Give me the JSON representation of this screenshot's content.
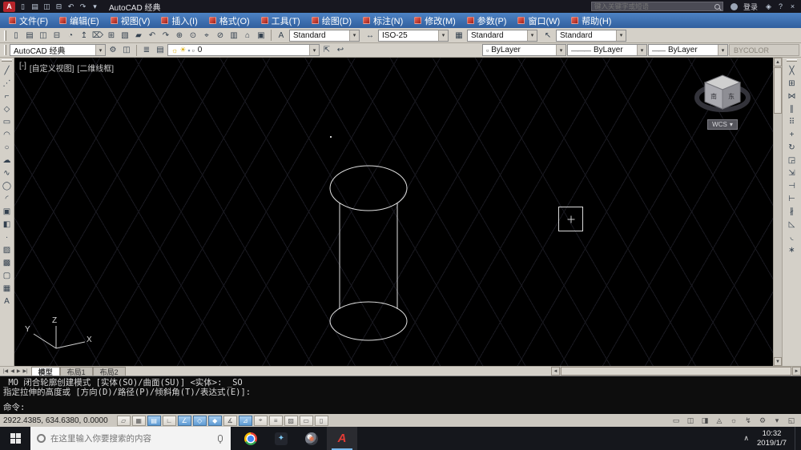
{
  "glyphs": {
    "chevron_down": "▾",
    "scroll_up": "▲",
    "scroll_down": "▼",
    "scroll_left": "◄",
    "scroll_right": "►"
  },
  "title_bar": {
    "app_logo": "A",
    "quick_access": [
      {
        "name": "qa-new-icon",
        "glyph": "▯"
      },
      {
        "name": "qa-open-icon",
        "glyph": "▤"
      },
      {
        "name": "qa-save-icon",
        "glyph": "◫"
      },
      {
        "name": "qa-plot-icon",
        "glyph": "⊟"
      },
      {
        "name": "qa-undo-icon",
        "glyph": "↶"
      },
      {
        "name": "qa-redo-icon",
        "glyph": "↷"
      },
      {
        "name": "qa-dropdown-icon",
        "glyph": "▾"
      }
    ],
    "title": "AutoCAD 经典",
    "search_placeholder": "键入关键字或短语",
    "signin_label": "登录",
    "right_icons": [
      {
        "name": "exchange-apps-icon",
        "glyph": "◈"
      },
      {
        "name": "help-icon",
        "glyph": "?"
      },
      {
        "name": "close-icon",
        "glyph": "×"
      }
    ]
  },
  "menu_bar": {
    "items": [
      {
        "label": "文件(F)"
      },
      {
        "label": "编辑(E)"
      },
      {
        "label": "视图(V)"
      },
      {
        "label": "插入(I)"
      },
      {
        "label": "格式(O)"
      },
      {
        "label": "工具(T)"
      },
      {
        "label": "绘图(D)"
      },
      {
        "label": "标注(N)"
      },
      {
        "label": "修改(M)"
      },
      {
        "label": "参数(P)"
      },
      {
        "label": "窗口(W)"
      },
      {
        "label": "帮助(H)"
      }
    ]
  },
  "standard_toolbar": {
    "icons": [
      {
        "name": "new-icon",
        "glyph": "▯"
      },
      {
        "name": "open-icon",
        "glyph": "▤"
      },
      {
        "name": "save-icon",
        "glyph": "◫"
      },
      {
        "name": "print-icon",
        "glyph": "⊟"
      },
      {
        "name": "plot-preview-icon",
        "glyph": "◔"
      },
      {
        "name": "publish-icon",
        "glyph": "↥"
      },
      {
        "name": "cut-icon",
        "glyph": "⌦"
      },
      {
        "name": "copy-clip-icon",
        "glyph": "⊞"
      },
      {
        "name": "paste-icon",
        "glyph": "▧"
      },
      {
        "name": "match-properties-icon",
        "glyph": "▰"
      },
      {
        "name": "undo-icon",
        "glyph": "↶"
      },
      {
        "name": "redo-icon",
        "glyph": "↷"
      },
      {
        "name": "pan-icon",
        "glyph": "⊕"
      },
      {
        "name": "zoom-realtime-icon",
        "glyph": "⊙"
      },
      {
        "name": "zoom-window-icon",
        "glyph": "⌖"
      },
      {
        "name": "zoom-previous-icon",
        "glyph": "⊘"
      },
      {
        "name": "properties-icon",
        "glyph": "▥"
      },
      {
        "name": "designcenter-icon",
        "glyph": "⌂"
      },
      {
        "name": "tool-palettes-icon",
        "glyph": "▣"
      }
    ]
  },
  "styles_toolbar": {
    "combos": [
      {
        "name": "text-style-combo",
        "icon_name": "text-style-icon",
        "icon": "A",
        "value": "Standard"
      },
      {
        "name": "dim-style-combo",
        "icon_name": "dim-style-icon",
        "icon": "↔",
        "value": "ISO-25"
      },
      {
        "name": "table-style-combo",
        "icon_name": "table-style-icon",
        "icon": "▦",
        "value": "Standard"
      },
      {
        "name": "mleader-style-combo",
        "icon_name": "mleader-style-icon",
        "icon": "↖",
        "value": "Standard"
      }
    ]
  },
  "workspace_toolbar": {
    "value": "AutoCAD 经典",
    "gear_glyph": "⚙",
    "save_glyph": "◫"
  },
  "layers_toolbar": {
    "buttons": [
      {
        "name": "layer-properties-icon",
        "glyph": "≣"
      },
      {
        "name": "layer-states-icon",
        "glyph": "▤"
      }
    ],
    "combo": {
      "toggles": [
        {
          "name": "layer-on-icon",
          "glyph": "☼",
          "color": "#d8a800"
        },
        {
          "name": "layer-freeze-icon",
          "glyph": "☀",
          "color": "#d8a800"
        },
        {
          "name": "layer-lock-icon",
          "glyph": "▪",
          "color": "#7d93a8"
        },
        {
          "name": "layer-color-chip",
          "glyph": "▫",
          "color": "#555555"
        }
      ],
      "value": "0"
    },
    "extra_buttons": [
      {
        "name": "make-current-icon",
        "glyph": "⇱"
      },
      {
        "name": "layer-previous-icon",
        "glyph": "↩"
      }
    ]
  },
  "properties_toolbar": {
    "color": {
      "value": "ByLayer"
    },
    "linetype": {
      "sample": "———",
      "value": "ByLayer"
    },
    "lineweight": {
      "sample": "——",
      "value": "ByLayer"
    },
    "plot_style": {
      "value": "BYCOLOR"
    }
  },
  "draw_toolbar": {
    "icons": [
      {
        "name": "line-icon",
        "glyph": "╱"
      },
      {
        "name": "construction-line-icon",
        "glyph": "⋰"
      },
      {
        "name": "polyline-icon",
        "glyph": "⌐"
      },
      {
        "name": "polygon-icon",
        "glyph": "◇"
      },
      {
        "name": "rectangle-icon",
        "glyph": "▭"
      },
      {
        "name": "arc-icon",
        "glyph": "◠"
      },
      {
        "name": "circle-icon",
        "glyph": "○"
      },
      {
        "name": "revision-cloud-icon",
        "glyph": "☁"
      },
      {
        "name": "spline-icon",
        "glyph": "∿"
      },
      {
        "name": "ellipse-icon",
        "glyph": "◯"
      },
      {
        "name": "ellipse-arc-icon",
        "glyph": "◜"
      },
      {
        "name": "insert-block-icon",
        "glyph": "▣"
      },
      {
        "name": "make-block-icon",
        "glyph": "◧"
      },
      {
        "name": "point-icon",
        "glyph": "∙"
      },
      {
        "name": "hatch-icon",
        "glyph": "▨"
      },
      {
        "name": "gradient-icon",
        "glyph": "▩"
      },
      {
        "name": "region-icon",
        "glyph": "▢"
      },
      {
        "name": "table-icon",
        "glyph": "▦"
      },
      {
        "name": "mtext-icon",
        "glyph": "A"
      }
    ]
  },
  "modify_toolbar": {
    "icons": [
      {
        "name": "erase-icon",
        "glyph": "╳"
      },
      {
        "name": "copy-icon",
        "glyph": "⊞"
      },
      {
        "name": "mirror-icon",
        "glyph": "⋈"
      },
      {
        "name": "offset-icon",
        "glyph": "∥"
      },
      {
        "name": "array-icon",
        "glyph": "⠿"
      },
      {
        "name": "move-icon",
        "glyph": "+"
      },
      {
        "name": "rotate-icon",
        "glyph": "↻"
      },
      {
        "name": "scale-icon",
        "glyph": "◲"
      },
      {
        "name": "stretch-icon",
        "glyph": "⇲"
      },
      {
        "name": "trim-icon",
        "glyph": "⊣"
      },
      {
        "name": "extend-icon",
        "glyph": "⊢"
      },
      {
        "name": "break-icon",
        "glyph": "∦"
      },
      {
        "name": "chamfer-icon",
        "glyph": "◺"
      },
      {
        "name": "fillet-icon",
        "glyph": "◟"
      },
      {
        "name": "explode-icon",
        "glyph": "∗"
      }
    ]
  },
  "canvas": {
    "view_controls": {
      "collapse": "[-]",
      "view_name": "[自定义视图]",
      "visual_style": "[二维线框]"
    },
    "viewcube": {
      "face_front": "南",
      "face_right": "东",
      "wcs_label": "WCS",
      "wcs_arrow": "▾"
    },
    "ucs": {
      "x": "X",
      "y": "Y",
      "z": "Z"
    }
  },
  "layout_tabs": {
    "nav": [
      {
        "name": "first-tab-icon",
        "glyph": "|◀"
      },
      {
        "name": "prev-tab-icon",
        "glyph": "◀"
      },
      {
        "name": "next-tab-icon",
        "glyph": "▶"
      },
      {
        "name": "last-tab-icon",
        "glyph": "▶|"
      }
    ],
    "tabs": [
      {
        "label": "模型",
        "active": true
      },
      {
        "label": "布局1",
        "active": false
      },
      {
        "label": "布局2",
        "active": false
      }
    ]
  },
  "command_window": {
    "history": [
      "_MO 闭合轮廓创建模式 [实体(SO)/曲面(SU)] <实体>: _SO",
      "指定拉伸的高度或 [方向(D)/路径(P)/倾斜角(T)/表达式(E)]:"
    ],
    "prompt": "命令:"
  },
  "status_bar": {
    "coordinates": "2922.4385, 634.6380, 0.0000",
    "toggles": [
      {
        "name": "infer-constraints-toggle",
        "glyph": "▱",
        "active": false
      },
      {
        "name": "snap-toggle",
        "glyph": "▦",
        "active": false
      },
      {
        "name": "grid-toggle",
        "glyph": "▤",
        "active": true
      },
      {
        "name": "ortho-toggle",
        "glyph": "∟",
        "active": false
      },
      {
        "name": "polar-toggle",
        "glyph": "∠",
        "active": true
      },
      {
        "name": "osnap-toggle",
        "glyph": "◇",
        "active": true
      },
      {
        "name": "osnap-3d-toggle",
        "glyph": "◆",
        "active": true
      },
      {
        "name": "otrack-toggle",
        "glyph": "∡",
        "active": false
      },
      {
        "name": "ducs-toggle",
        "glyph": "⊿",
        "active": true
      },
      {
        "name": "dyn-toggle",
        "glyph": "⌖",
        "active": false
      },
      {
        "name": "lineweight-toggle",
        "glyph": "≡",
        "active": false
      },
      {
        "name": "transparency-toggle",
        "glyph": "▨",
        "active": false
      },
      {
        "name": "quick-properties-toggle",
        "glyph": "▭",
        "active": false
      },
      {
        "name": "selection-cycling-toggle",
        "glyph": "▯",
        "active": false
      }
    ],
    "right_icons": [
      {
        "name": "model-space-icon",
        "glyph": "▭"
      },
      {
        "name": "quick-view-layouts-icon",
        "glyph": "◫"
      },
      {
        "name": "quick-view-drawings-icon",
        "glyph": "◨"
      },
      {
        "name": "annotation-scale-icon",
        "glyph": "◬"
      },
      {
        "name": "annotation-visibility-icon",
        "glyph": "☼"
      },
      {
        "name": "autoscale-icon",
        "glyph": "↯"
      },
      {
        "name": "workspace-switch-icon",
        "glyph": "⚙"
      },
      {
        "name": "statusbar-menu-icon",
        "glyph": "▾"
      },
      {
        "name": "cleanscreen-icon",
        "glyph": "◱"
      }
    ]
  },
  "taskbar": {
    "search_placeholder": "在这里输入你要搜索的内容",
    "apps": [
      {
        "name": "chrome-icon",
        "glyph": ""
      },
      {
        "name": "media-app-icon",
        "glyph": "✦"
      },
      {
        "name": "capture-app-icon",
        "glyph": "◉"
      },
      {
        "name": "autocad-taskbar-icon",
        "glyph": "A",
        "active": true
      }
    ],
    "tray": {
      "icons": [
        {
          "name": "tray-expand-icon",
          "glyph": "∧"
        }
      ],
      "time": "10:32",
      "date": "2019/1/7"
    }
  }
}
